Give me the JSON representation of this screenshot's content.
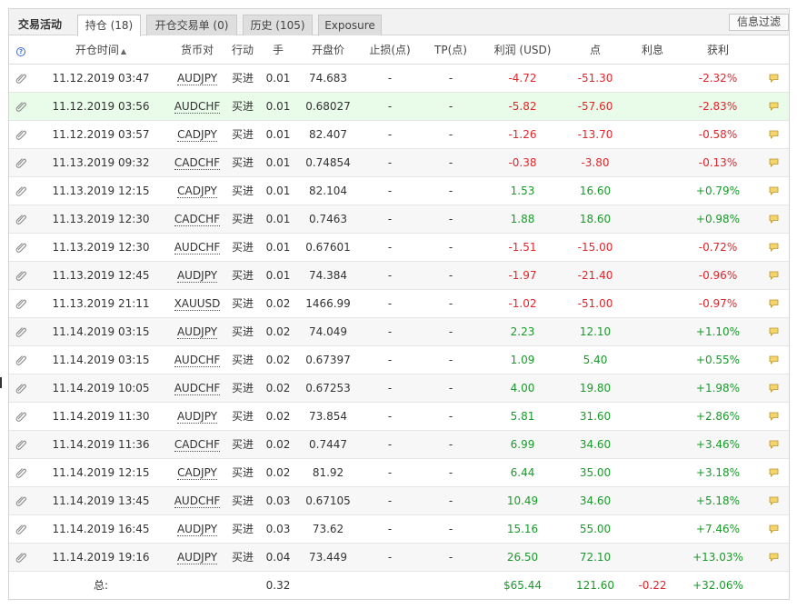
{
  "tabs": {
    "title": "交易活动",
    "items": [
      {
        "label": "持仓 (18)",
        "active": true
      },
      {
        "label": "开仓交易单 (0)",
        "active": false
      },
      {
        "label": "历史 (105)",
        "active": false
      },
      {
        "label": "Exposure",
        "active": false
      }
    ],
    "info_filter": "信息过滤"
  },
  "columns": {
    "help": "?",
    "open_time": "开仓时间",
    "symbol": "货币对",
    "action": "行动",
    "lots": "手",
    "open_price": "开盘价",
    "sl": "止损(点)",
    "tp": "TP(点)",
    "profit": "利润 (USD)",
    "points": "点",
    "interest": "利息",
    "gain": "获利"
  },
  "rows": [
    {
      "time": "11.12.2019 03:47",
      "symbol": "AUDJPY",
      "action": "买进",
      "lots": "0.01",
      "price": "74.683",
      "sl": "-",
      "tp": "-",
      "profit": "-4.72",
      "points": "-51.30",
      "interest": "",
      "gain": "-2.32%",
      "sign": "neg"
    },
    {
      "time": "11.12.2019 03:56",
      "symbol": "AUDCHF",
      "action": "买进",
      "lots": "0.01",
      "price": "0.68027",
      "sl": "-",
      "tp": "-",
      "profit": "-5.82",
      "points": "-57.60",
      "interest": "",
      "gain": "-2.83%",
      "sign": "neg"
    },
    {
      "time": "11.12.2019 03:57",
      "symbol": "CADJPY",
      "action": "买进",
      "lots": "0.01",
      "price": "82.407",
      "sl": "-",
      "tp": "-",
      "profit": "-1.26",
      "points": "-13.70",
      "interest": "",
      "gain": "-0.58%",
      "sign": "neg"
    },
    {
      "time": "11.13.2019 09:32",
      "symbol": "CADCHF",
      "action": "买进",
      "lots": "0.01",
      "price": "0.74854",
      "sl": "-",
      "tp": "-",
      "profit": "-0.38",
      "points": "-3.80",
      "interest": "",
      "gain": "-0.13%",
      "sign": "neg"
    },
    {
      "time": "11.13.2019 12:15",
      "symbol": "CADJPY",
      "action": "买进",
      "lots": "0.01",
      "price": "82.104",
      "sl": "-",
      "tp": "-",
      "profit": "1.53",
      "points": "16.60",
      "interest": "",
      "gain": "+0.79%",
      "sign": "pos"
    },
    {
      "time": "11.13.2019 12:30",
      "symbol": "CADCHF",
      "action": "买进",
      "lots": "0.01",
      "price": "0.7463",
      "sl": "-",
      "tp": "-",
      "profit": "1.88",
      "points": "18.60",
      "interest": "",
      "gain": "+0.98%",
      "sign": "pos"
    },
    {
      "time": "11.13.2019 12:30",
      "symbol": "AUDCHF",
      "action": "买进",
      "lots": "0.01",
      "price": "0.67601",
      "sl": "-",
      "tp": "-",
      "profit": "-1.51",
      "points": "-15.00",
      "interest": "",
      "gain": "-0.72%",
      "sign": "neg"
    },
    {
      "time": "11.13.2019 12:45",
      "symbol": "AUDJPY",
      "action": "买进",
      "lots": "0.01",
      "price": "74.384",
      "sl": "-",
      "tp": "-",
      "profit": "-1.97",
      "points": "-21.40",
      "interest": "",
      "gain": "-0.96%",
      "sign": "neg"
    },
    {
      "time": "11.13.2019 21:11",
      "symbol": "XAUUSD",
      "action": "买进",
      "lots": "0.02",
      "price": "1466.99",
      "sl": "-",
      "tp": "-",
      "profit": "-1.02",
      "points": "-51.00",
      "interest": "",
      "gain": "-0.97%",
      "sign": "neg"
    },
    {
      "time": "11.14.2019 03:15",
      "symbol": "AUDJPY",
      "action": "买进",
      "lots": "0.02",
      "price": "74.049",
      "sl": "-",
      "tp": "-",
      "profit": "2.23",
      "points": "12.10",
      "interest": "",
      "gain": "+1.10%",
      "sign": "pos"
    },
    {
      "time": "11.14.2019 03:15",
      "symbol": "AUDCHF",
      "action": "买进",
      "lots": "0.02",
      "price": "0.67397",
      "sl": "-",
      "tp": "-",
      "profit": "1.09",
      "points": "5.40",
      "interest": "",
      "gain": "+0.55%",
      "sign": "pos"
    },
    {
      "time": "11.14.2019 10:05",
      "symbol": "AUDCHF",
      "action": "买进",
      "lots": "0.02",
      "price": "0.67253",
      "sl": "-",
      "tp": "-",
      "profit": "4.00",
      "points": "19.80",
      "interest": "",
      "gain": "+1.98%",
      "sign": "pos"
    },
    {
      "time": "11.14.2019 11:30",
      "symbol": "AUDJPY",
      "action": "买进",
      "lots": "0.02",
      "price": "73.854",
      "sl": "-",
      "tp": "-",
      "profit": "5.81",
      "points": "31.60",
      "interest": "",
      "gain": "+2.86%",
      "sign": "pos"
    },
    {
      "time": "11.14.2019 11:36",
      "symbol": "CADCHF",
      "action": "买进",
      "lots": "0.02",
      "price": "0.7447",
      "sl": "-",
      "tp": "-",
      "profit": "6.99",
      "points": "34.60",
      "interest": "",
      "gain": "+3.46%",
      "sign": "pos"
    },
    {
      "time": "11.14.2019 12:15",
      "symbol": "CADJPY",
      "action": "买进",
      "lots": "0.02",
      "price": "81.92",
      "sl": "-",
      "tp": "-",
      "profit": "6.44",
      "points": "35.00",
      "interest": "",
      "gain": "+3.18%",
      "sign": "pos"
    },
    {
      "time": "11.14.2019 13:45",
      "symbol": "AUDCHF",
      "action": "买进",
      "lots": "0.03",
      "price": "0.67105",
      "sl": "-",
      "tp": "-",
      "profit": "10.49",
      "points": "34.60",
      "interest": "",
      "gain": "+5.18%",
      "sign": "pos"
    },
    {
      "time": "11.14.2019 16:45",
      "symbol": "AUDJPY",
      "action": "买进",
      "lots": "0.03",
      "price": "73.62",
      "sl": "-",
      "tp": "-",
      "profit": "15.16",
      "points": "55.00",
      "interest": "",
      "gain": "+7.46%",
      "sign": "pos"
    },
    {
      "time": "11.14.2019 19:16",
      "symbol": "AUDJPY",
      "action": "买进",
      "lots": "0.04",
      "price": "73.449",
      "sl": "-",
      "tp": "-",
      "profit": "26.50",
      "points": "72.10",
      "interest": "",
      "gain": "+13.03%",
      "sign": "pos"
    }
  ],
  "highlighted_row": 1,
  "totals": {
    "label": "总:",
    "lots": "0.32",
    "profit": "$65.44",
    "points": "121.60",
    "interest": "-0.22",
    "gain": "+32.06%"
  },
  "colors": {
    "negative": "#e0262b",
    "positive": "#1a9a2a",
    "highlight": "#e9fbe9"
  },
  "icons": {
    "row_leading": "paperclip-icon",
    "row_trailing": "comment-bubble-icon",
    "header_help": "help-icon"
  }
}
